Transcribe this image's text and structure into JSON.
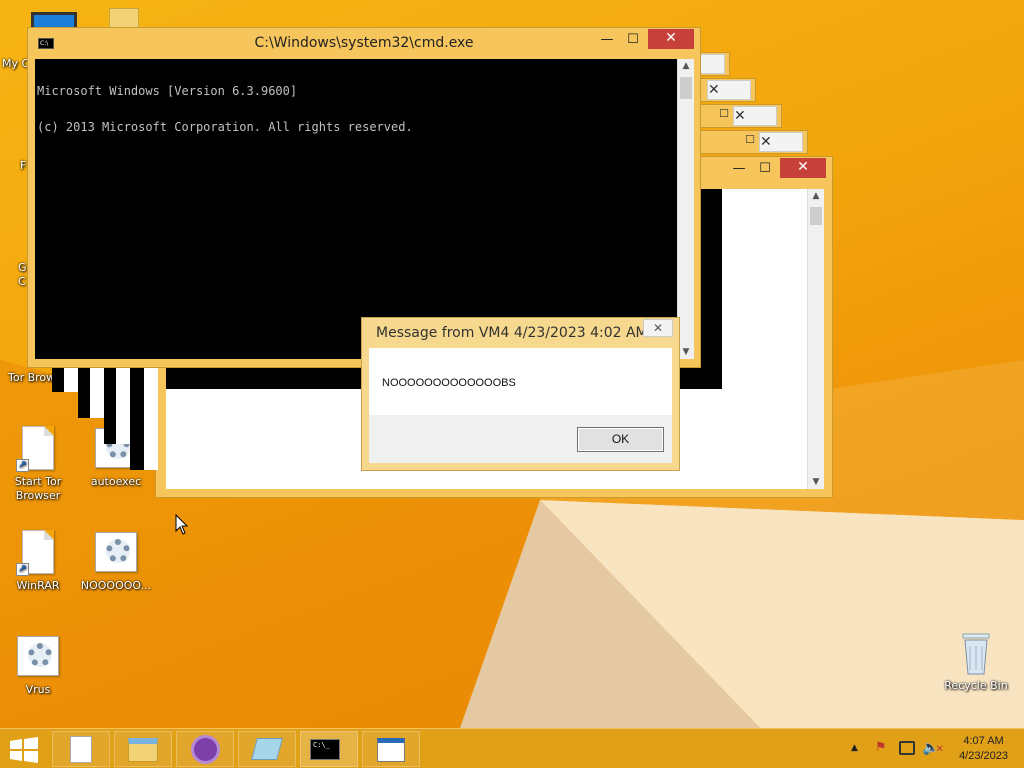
{
  "desktop": {
    "icons": [
      {
        "label": "My C",
        "icon": "computer-icon"
      },
      {
        "label": "F",
        "icon": "shortcut-icon"
      },
      {
        "label": "G",
        "label2": "C",
        "icon": "shortcut-icon"
      },
      {
        "label": "Tor Brow",
        "icon": "folder-icon"
      },
      {
        "label": "Start Tor",
        "label2": "Browser",
        "icon": "document-shortcut-icon"
      },
      {
        "label": "autoexec",
        "icon": "settings-file-icon"
      },
      {
        "label": "WinRAR",
        "icon": "document-shortcut-icon"
      },
      {
        "label": "NOOOOOO...",
        "icon": "settings-file-icon"
      },
      {
        "label": "Vrus",
        "icon": "settings-file-icon"
      },
      {
        "label": "Recycle Bin",
        "icon": "recycle-bin-icon"
      }
    ]
  },
  "cmd_window": {
    "title": "C:\\Windows\\system32\\cmd.exe",
    "line1": "Microsoft Windows [Version 6.3.9600]",
    "line2": "(c) 2013 Microsoft Corporation. All rights reserved.",
    "min_glyph": "—",
    "max_glyph": "☐",
    "close_glyph": "✕"
  },
  "message_box": {
    "title": "Message from VM4 4/23/2023 4:02 AM",
    "text": "NOOOOOOOOOOOOOBS",
    "ok_label": "OK",
    "close_glyph": "✕"
  },
  "taskbar": {
    "items": [
      "start-button",
      "notepad-task",
      "file-explorer-task",
      "tor-browser-task",
      "notepad-alt-task",
      "cmd-task",
      "wordpad-task"
    ],
    "clock_time": "4:07 AM",
    "clock_date": "4/23/2023"
  },
  "colors": {
    "desktop": "#f2a50c",
    "taskbar": "#e0a018",
    "window_frame": "#f6c65c",
    "close_button": "#c7403a"
  }
}
